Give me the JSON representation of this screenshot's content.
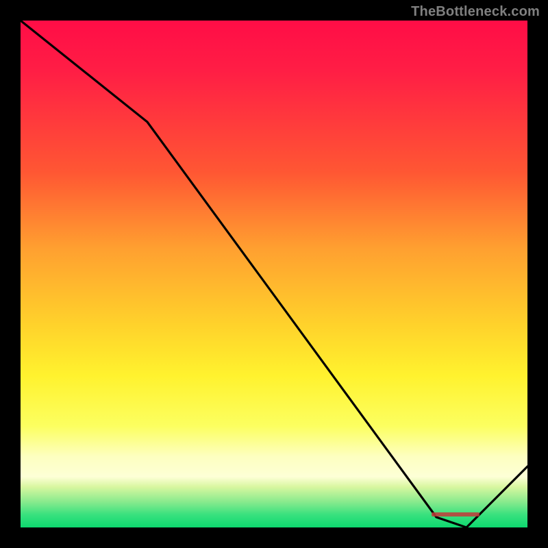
{
  "watermark": "TheBottleneck.com",
  "marker": {
    "label": ""
  },
  "chart_data": {
    "type": "line",
    "title": "",
    "xlabel": "",
    "ylabel": "",
    "xlim": [
      0,
      100
    ],
    "ylim": [
      0,
      100
    ],
    "x": [
      0,
      25,
      82,
      88,
      100
    ],
    "values": [
      100,
      80,
      2,
      0,
      12
    ],
    "background_gradient": {
      "orientation": "vertical",
      "stops": [
        {
          "pct": 0,
          "color": "#ff0d46"
        },
        {
          "pct": 30,
          "color": "#ff5733"
        },
        {
          "pct": 60,
          "color": "#ffd22b"
        },
        {
          "pct": 80,
          "color": "#fcff60"
        },
        {
          "pct": 90,
          "color": "#fdffd6"
        },
        {
          "pct": 97,
          "color": "#38e17e"
        },
        {
          "pct": 100,
          "color": "#0dd86f"
        }
      ]
    },
    "annotations": [
      {
        "x": 85,
        "y": 2,
        "text": ""
      }
    ]
  }
}
